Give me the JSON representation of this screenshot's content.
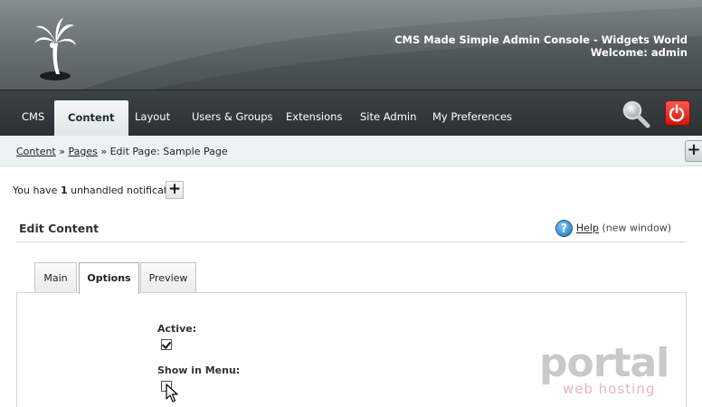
{
  "header": {
    "line1": "CMS Made Simple Admin Console - Widgets World",
    "line2": "Welcome: admin"
  },
  "nav": {
    "items": [
      {
        "label": "CMS"
      },
      {
        "label": "Content",
        "active": true
      },
      {
        "label": "Layout"
      },
      {
        "label": "Users & Groups"
      },
      {
        "label": "Extensions"
      },
      {
        "label": "Site Admin"
      },
      {
        "label": "My Preferences"
      }
    ],
    "icons": [
      "search-icon",
      "logout-power-icon"
    ]
  },
  "breadcrumb": {
    "content": "Content",
    "sep1": "»",
    "pages": "Pages",
    "rest": "» Edit Page: Sample Page"
  },
  "notification": {
    "prefix": "You have",
    "count": "1",
    "suffix": "unhandled notification",
    "toggle": "+"
  },
  "edit": {
    "title": "Edit Content",
    "help_link": "Help",
    "help_sub": "(new window)"
  },
  "tabs": [
    {
      "label": "Main"
    },
    {
      "label": "Options",
      "active": true
    },
    {
      "label": "Preview"
    }
  ],
  "fields": {
    "active_label": "Active:",
    "active_checked": true,
    "show_in_menu_label": "Show in Menu:",
    "show_in_menu_checked": false
  },
  "watermark": {
    "main": "portal",
    "sub": "web hosting"
  },
  "colors": {
    "nav_bg": "#2f3538",
    "active_tab": "#e6ebec",
    "power_red": "#e02418",
    "crumb_bg": "#edf2f5"
  }
}
